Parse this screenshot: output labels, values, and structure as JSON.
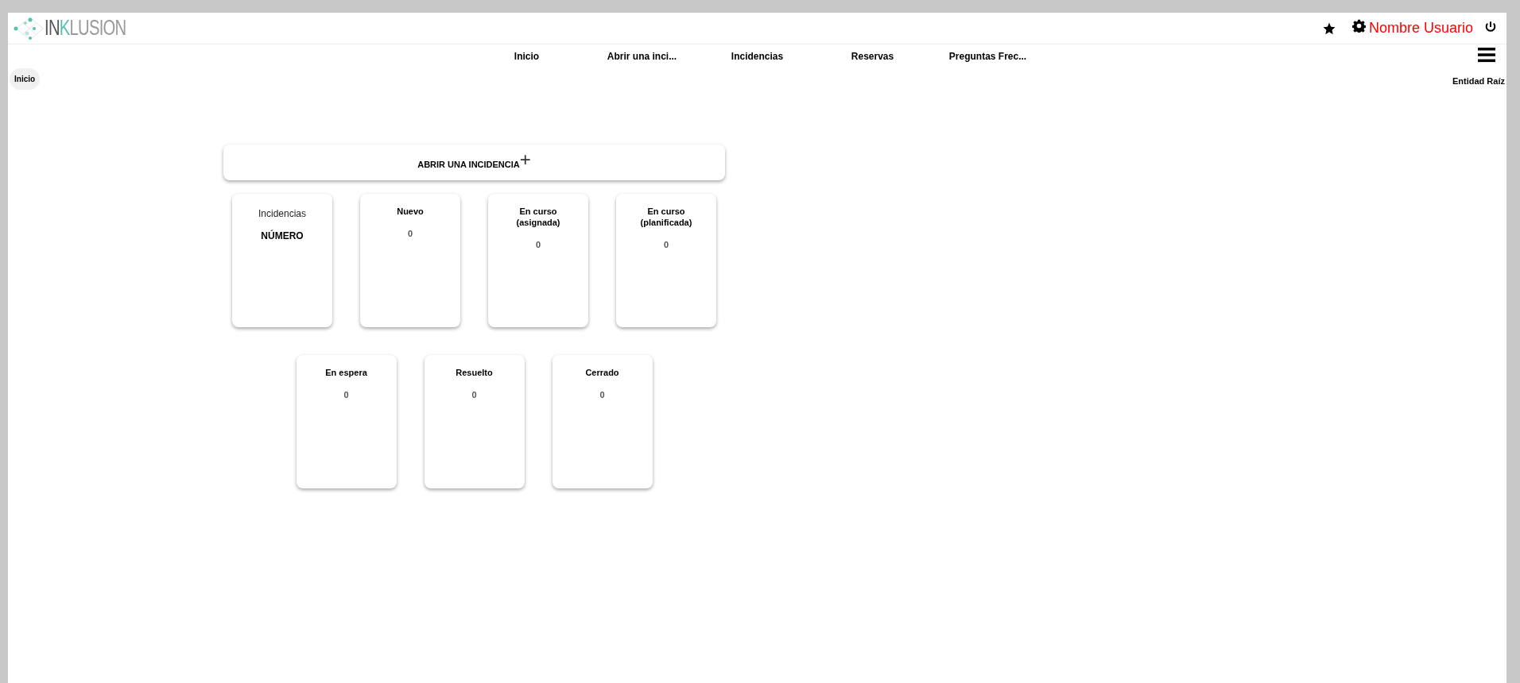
{
  "logo": {
    "parts": [
      {
        "text": "IN",
        "kind": "dark"
      },
      {
        "text": "K",
        "kind": "accent"
      },
      {
        "text": "LUSION",
        "kind": "light"
      }
    ]
  },
  "user": {
    "name": "Nombre Usuario"
  },
  "nav": [
    {
      "label": "Inicio"
    },
    {
      "label": "Abrir una inci..."
    },
    {
      "label": "Incidencias"
    },
    {
      "label": "Reservas"
    },
    {
      "label": "Preguntas Frec..."
    }
  ],
  "breadcrumb": [
    "Inicio"
  ],
  "entity": "Entidad Raíz",
  "open_button": {
    "label": "ABRIR UNA INCIDENCIA",
    "icon": "+"
  },
  "card_rows": [
    [
      {
        "kind": "header",
        "title": "Incidencias",
        "value": "NÚMERO"
      },
      {
        "kind": "status",
        "title": "Nuevo",
        "value": "0"
      },
      {
        "kind": "status",
        "title": "En curso (asignada)",
        "value": "0"
      },
      {
        "kind": "status",
        "title": "En curso (planificada)",
        "value": "0"
      }
    ],
    [
      {
        "kind": "status",
        "title": "En espera",
        "value": "0"
      },
      {
        "kind": "status",
        "title": "Resuelto",
        "value": "0"
      },
      {
        "kind": "status",
        "title": "Cerrado",
        "value": "0"
      }
    ]
  ]
}
